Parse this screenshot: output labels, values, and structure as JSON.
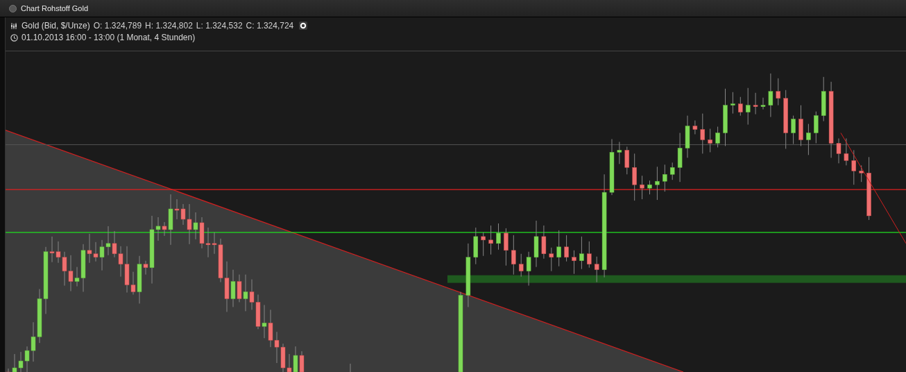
{
  "window": {
    "title": "Chart Rohstoff Gold"
  },
  "legend": {
    "instrument": "Gold (Bid, $/Unze)",
    "quotes": [
      "O: 1.324,789",
      "H: 1.324,802",
      "L: 1.324,532",
      "C: 1.324,724"
    ],
    "period": "01.10.2013 16:00 - 13:00 (1 Monat, 4 Stunden)"
  }
}
